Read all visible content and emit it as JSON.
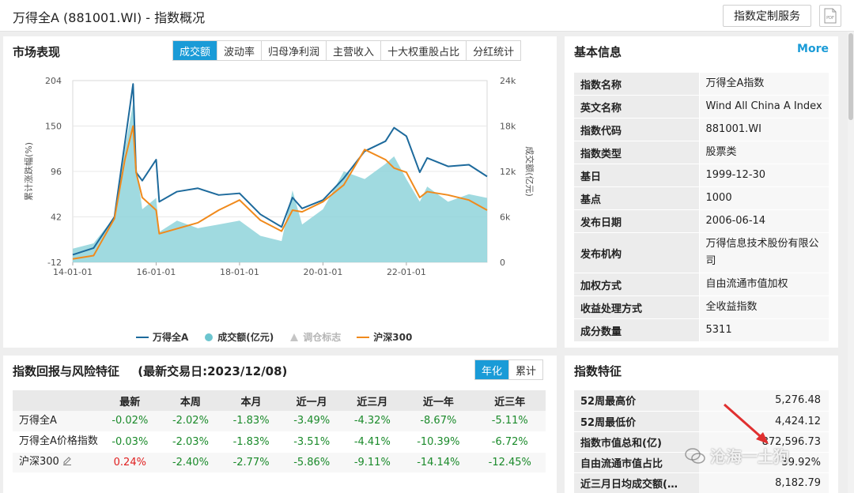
{
  "header": {
    "title": "万得全A (881001.WI) - 指数概况",
    "custom_service_label": "指数定制服务",
    "pdf_label": "PDF"
  },
  "market": {
    "title": "市场表现",
    "tabs": [
      "成交额",
      "波动率",
      "归母净利润",
      "主营收入",
      "十大权重股占比",
      "分红统计"
    ],
    "active_tab": 0
  },
  "chart_data": {
    "type": "line",
    "x_ticks": [
      "14-01-01",
      "16-01-01",
      "18-01-01",
      "20-01-01",
      "22-01-01"
    ],
    "y_left_ticks": [
      "204",
      "150",
      "96",
      "42",
      "-12"
    ],
    "y_left_label": "累计涨跌幅(%)",
    "y_left_range": [
      -12,
      204
    ],
    "y_right_ticks": [
      "24k",
      "18k",
      "12k",
      "6k",
      "0"
    ],
    "y_right_label": "成交额(亿元)",
    "y_right_range": [
      0,
      24000
    ],
    "legend": [
      "万得全A",
      "成交额(亿元)",
      "调仓标志",
      "沪深300"
    ],
    "series": [
      {
        "name": "万得全A",
        "color": "#1d6a9c",
        "x": [
          "14-01-01",
          "14-07-01",
          "15-01-01",
          "15-04-01",
          "15-06-12",
          "15-07-08",
          "15-09-01",
          "16-01-01",
          "16-01-28",
          "16-07-01",
          "17-01-01",
          "17-07-01",
          "18-01-01",
          "18-07-01",
          "19-01-04",
          "19-04-08",
          "19-07-01",
          "20-01-01",
          "20-07-01",
          "21-01-01",
          "21-07-01",
          "21-09-15",
          "22-01-01",
          "22-04-27",
          "22-07-01",
          "23-01-01",
          "23-07-01",
          "23-12-08"
        ],
        "y": [
          -3,
          5,
          42,
          130,
          200,
          95,
          85,
          110,
          60,
          72,
          76,
          68,
          70,
          45,
          30,
          65,
          52,
          62,
          88,
          120,
          132,
          148,
          138,
          95,
          112,
          102,
          104,
          90
        ]
      },
      {
        "name": "沪深300",
        "color": "#f08a1c",
        "x": [
          "14-01-01",
          "14-07-01",
          "15-01-01",
          "15-04-01",
          "15-06-12",
          "15-07-08",
          "15-09-01",
          "16-01-01",
          "16-01-28",
          "16-07-01",
          "17-01-01",
          "17-07-01",
          "18-01-01",
          "18-07-01",
          "19-01-04",
          "19-04-08",
          "19-07-01",
          "20-01-01",
          "20-07-01",
          "21-01-01",
          "21-07-01",
          "21-09-15",
          "22-01-01",
          "22-04-27",
          "22-07-01",
          "23-01-01",
          "23-07-01",
          "23-12-08"
        ],
        "y": [
          -8,
          -4,
          40,
          110,
          150,
          95,
          65,
          50,
          22,
          28,
          35,
          50,
          62,
          38,
          25,
          50,
          48,
          60,
          80,
          122,
          110,
          100,
          95,
          65,
          72,
          68,
          62,
          50
        ]
      },
      {
        "name": "成交额(亿元)",
        "color": "#8fd3da",
        "x": [
          "14-01-01",
          "14-07-01",
          "15-01-01",
          "15-04-01",
          "15-06-12",
          "15-07-08",
          "15-09-01",
          "16-01-01",
          "16-01-28",
          "16-07-01",
          "17-01-01",
          "17-07-01",
          "18-01-01",
          "18-07-01",
          "19-01-04",
          "19-04-08",
          "19-07-01",
          "20-01-01",
          "20-07-01",
          "21-01-01",
          "21-07-01",
          "21-09-15",
          "22-01-01",
          "22-04-27",
          "22-07-01",
          "23-01-01",
          "23-07-01",
          "23-12-08"
        ],
        "y": [
          1800,
          2500,
          6000,
          15000,
          21000,
          13000,
          7000,
          8500,
          4000,
          5500,
          4500,
          5000,
          5500,
          3500,
          2800,
          9500,
          5000,
          7000,
          12000,
          11000,
          13000,
          14000,
          11000,
          8000,
          10000,
          8000,
          9000,
          8500
        ]
      }
    ]
  },
  "basic": {
    "title": "基本信息",
    "more": "More",
    "rows": [
      {
        "k": "指数名称",
        "v": "万得全A指数"
      },
      {
        "k": "英文名称",
        "v": "Wind All China A Index"
      },
      {
        "k": "指数代码",
        "v": "881001.WI"
      },
      {
        "k": "指数类型",
        "v": "股票类"
      },
      {
        "k": "基日",
        "v": "1999-12-30"
      },
      {
        "k": "基点",
        "v": "1000"
      },
      {
        "k": "发布日期",
        "v": "2006-06-14"
      },
      {
        "k": "发布机构",
        "v": "万得信息技术股份有限公司"
      },
      {
        "k": "加权方式",
        "v": "自由流通市值加权"
      },
      {
        "k": "收益处理方式",
        "v": "全收益指数"
      },
      {
        "k": "成分数量",
        "v": "5311"
      }
    ]
  },
  "returns": {
    "title": "指数回报与风险特征",
    "subtitle": "(最新交易日:2023/12/08)",
    "tabs": [
      "年化",
      "累计"
    ],
    "headers": [
      "",
      "最新",
      "本周",
      "本月",
      "近一月",
      "近三月",
      "近一年",
      "近三年"
    ],
    "rows": [
      {
        "name": "万得全A",
        "values": [
          "-0.02%",
          "-2.02%",
          "-1.83%",
          "-3.49%",
          "-4.32%",
          "-8.67%",
          "-5.11%"
        ]
      },
      {
        "name": "万得全A价格指数",
        "values": [
          "-0.03%",
          "-2.03%",
          "-1.83%",
          "-3.51%",
          "-4.41%",
          "-10.39%",
          "-6.72%"
        ]
      },
      {
        "name": "沪深300",
        "values": [
          "0.24%",
          "-2.40%",
          "-2.77%",
          "-5.86%",
          "-9.11%",
          "-14.14%",
          "-12.45%"
        ]
      }
    ]
  },
  "features": {
    "title": "指数特征",
    "rows": [
      {
        "k": "52周最高价",
        "v": "5,276.48"
      },
      {
        "k": "52周最低价",
        "v": "4,424.12"
      },
      {
        "k": "指数市值总和(亿)",
        "v": "872,596.73"
      },
      {
        "k": "自由流通市值占比",
        "v": "39.92%"
      },
      {
        "k": "近三月日均成交额(…",
        "v": "8,182.79"
      }
    ]
  },
  "watermark": {
    "text": "沧海一土狗"
  }
}
